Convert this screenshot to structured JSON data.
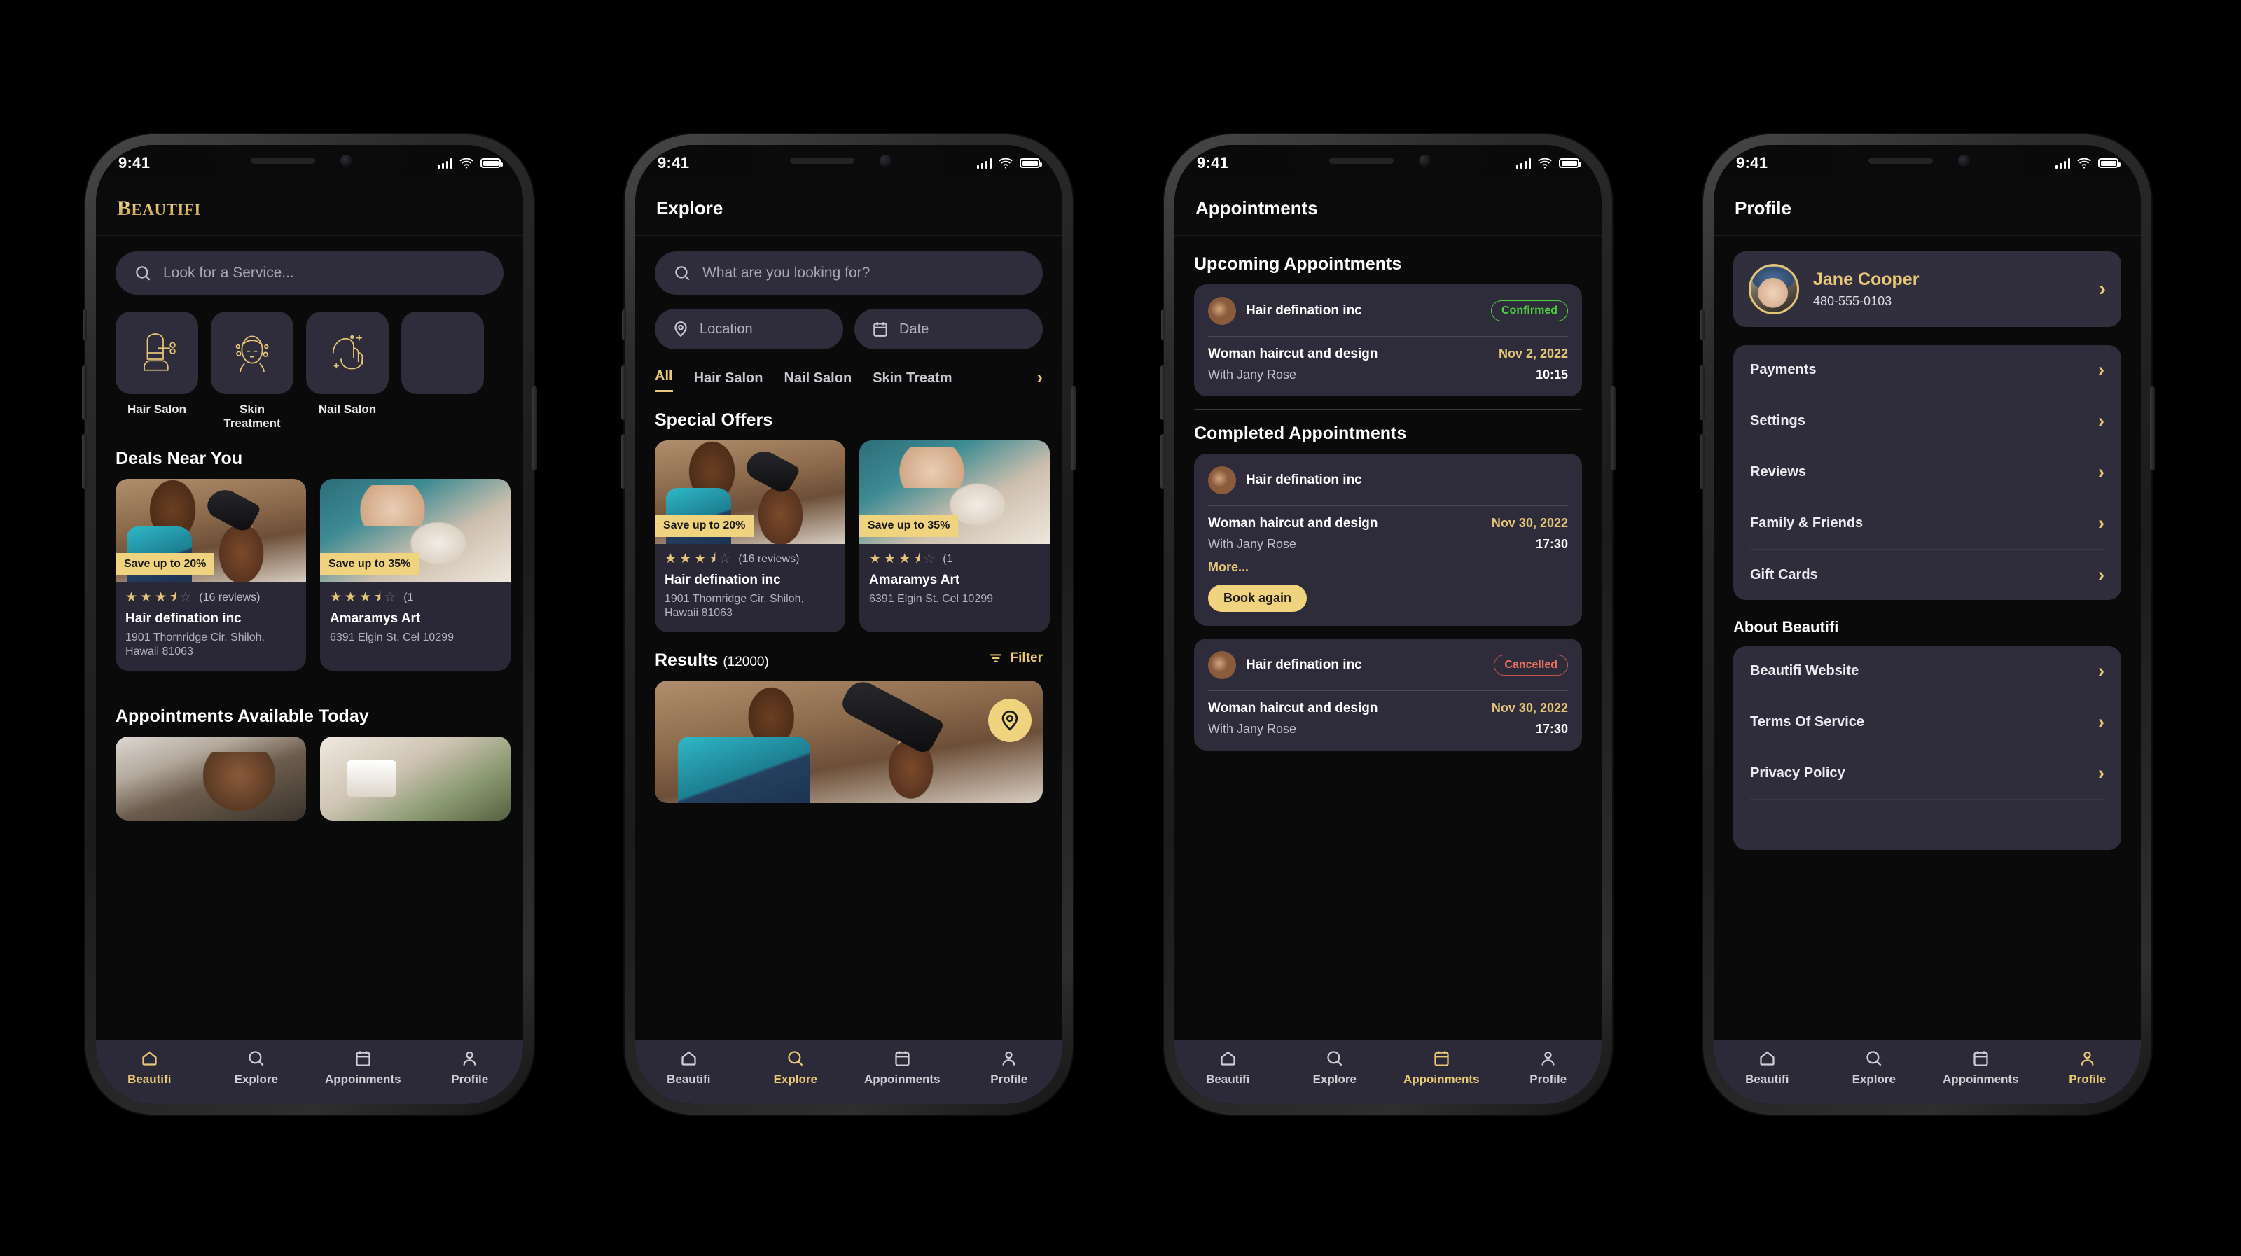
{
  "brand": {
    "name": "Beautifi",
    "logo_main": "B",
    "logo_text": "EAUTIFI",
    "accent": "#e3c478",
    "card_bg": "#2f2d3b"
  },
  "status_bar": {
    "time": "9:41",
    "signal": "signal-bars",
    "wifi": "wifi-icon",
    "battery": "battery-icon"
  },
  "tabbar": {
    "items": [
      {
        "label": "Beautifi",
        "icon": "home-icon"
      },
      {
        "label": "Explore",
        "icon": "search-icon"
      },
      {
        "label": "Appoinments",
        "icon": "calendar-icon"
      },
      {
        "label": "Profile",
        "icon": "person-icon"
      }
    ]
  },
  "screen1": {
    "active_tab": 0,
    "search": {
      "placeholder": "Look for a Service..."
    },
    "categories": [
      {
        "label": "Hair Salon",
        "icon": "haircut-icon"
      },
      {
        "label": "Skin Treatment",
        "icon": "facial-icon"
      },
      {
        "label": "Nail Salon",
        "icon": "nail-icon"
      },
      {
        "label": "",
        "icon": "more-icon"
      }
    ],
    "deals_title": "Deals Near You",
    "deals": [
      {
        "badge": "Save up to 20%",
        "rating": 3.5,
        "reviews": "(16 reviews)",
        "name": "Hair defination inc",
        "address": "1901 Thornridge Cir. Shiloh, Hawaii 81063",
        "photo": "salon"
      },
      {
        "badge": "Save up to 35%",
        "rating": 3.5,
        "reviews": "(1",
        "name": "Amaramys Art",
        "address": "6391 Elgin St. Cel 10299",
        "photo": "facial"
      }
    ],
    "available_title": "Appointments Available Today"
  },
  "screen2": {
    "active_tab": 1,
    "header_title": "Explore",
    "search": {
      "placeholder": "What are you looking for?"
    },
    "filters": [
      {
        "label": "Location",
        "icon": "pin-icon"
      },
      {
        "label": "Date",
        "icon": "calendar-icon"
      }
    ],
    "category_tabs": [
      "All",
      "Hair Salon",
      "Nail Salon",
      "Skin Treatm"
    ],
    "active_category": "All",
    "chevron": "chevron-right-icon",
    "offers_title": "Special Offers",
    "offers": [
      {
        "badge": "Save up to 20%",
        "rating": 3.5,
        "reviews": "(16 reviews)",
        "name": "Hair defination inc",
        "address": "1901 Thornridge Cir. Shiloh, Hawaii 81063",
        "photo": "salon"
      },
      {
        "badge": "Save up to 35%",
        "rating": 3.5,
        "reviews": "(1",
        "name": "Amaramys Art",
        "address": "6391 Elgin St. Cel 10299",
        "photo": "facial"
      }
    ],
    "results": {
      "title": "Results",
      "count": "(12000)",
      "filter_label": "Filter",
      "map_icon": "map-pin-icon"
    }
  },
  "screen3": {
    "active_tab": 2,
    "header_title": "Appointments",
    "upcoming_title": "Upcoming Appointments",
    "completed_title": "Completed Appointments",
    "upcoming": [
      {
        "salon": "Hair defination inc",
        "status": "Confirmed",
        "status_type": "confirmed",
        "service": "Woman haircut and design",
        "date": "Nov 2, 2022",
        "with": "With Jany Rose",
        "time": "10:15"
      }
    ],
    "completed": [
      {
        "salon": "Hair defination inc",
        "status": "",
        "status_type": "none",
        "service": "Woman haircut and design",
        "date": "Nov 30, 2022",
        "with": "With Jany Rose",
        "time": "17:30",
        "more": "More...",
        "book_again": "Book again"
      },
      {
        "salon": "Hair defination inc",
        "status": "Cancelled",
        "status_type": "cancelled",
        "service": "Woman haircut and design",
        "date": "Nov 30, 2022",
        "with": "With Jany Rose",
        "time": "17:30"
      }
    ]
  },
  "screen4": {
    "active_tab": 3,
    "header_title": "Profile",
    "user": {
      "name": "Jane Cooper",
      "phone": "480-555-0103",
      "chevron": "chevron-right-icon"
    },
    "menu": [
      "Payments",
      "Settings",
      "Reviews",
      "Family & Friends",
      "Gift Cards"
    ],
    "about_title": "About Beautifi",
    "about_menu": [
      "Beautifi Website",
      "Terms Of Service",
      "Privacy Policy"
    ]
  }
}
